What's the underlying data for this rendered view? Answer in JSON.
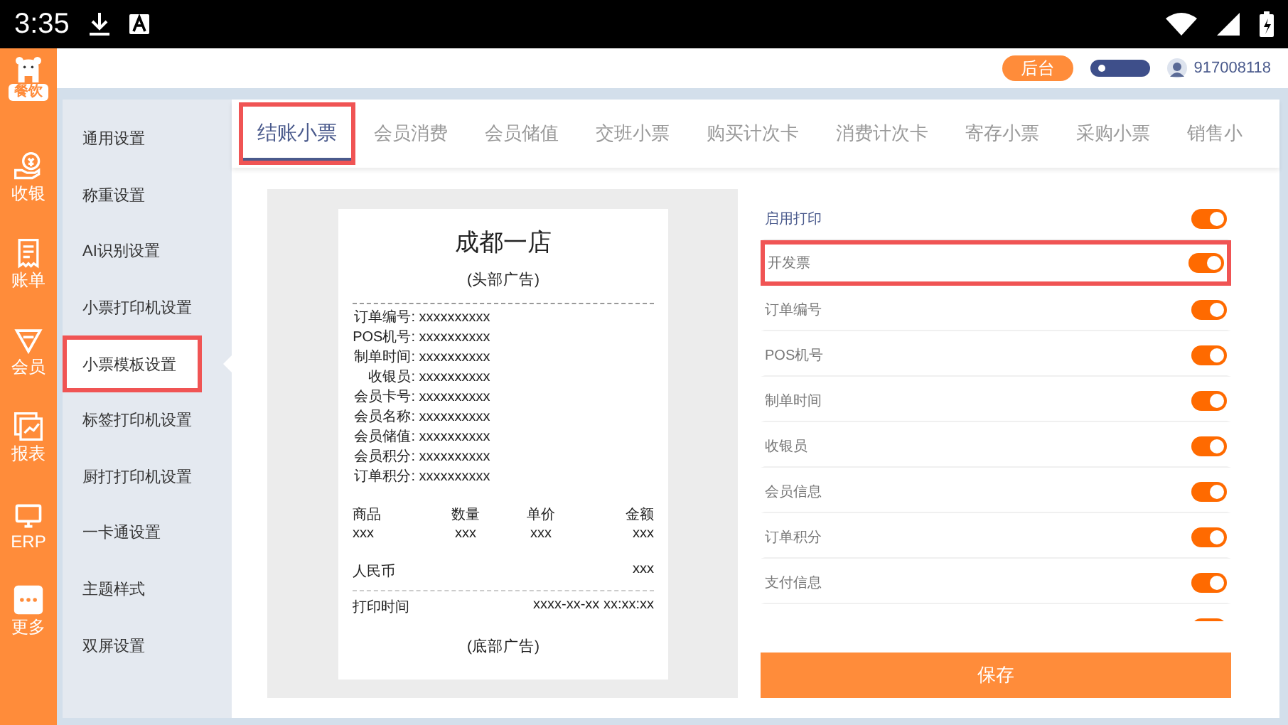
{
  "status_bar": {
    "time": "3:35"
  },
  "rail": {
    "logo_tag": "餐饮",
    "items": [
      {
        "label": "收银",
        "kind": "cash"
      },
      {
        "label": "账单",
        "kind": "bill"
      },
      {
        "label": "会员",
        "kind": "member"
      },
      {
        "label": "报表",
        "kind": "report"
      },
      {
        "label": "ERP",
        "kind": "erp"
      },
      {
        "label": "更多",
        "kind": "more"
      }
    ]
  },
  "header": {
    "backend_button": "后台",
    "account": "917008118"
  },
  "sidebar": {
    "items": [
      {
        "label": "通用设置",
        "selected": false,
        "highlighted": false
      },
      {
        "label": "称重设置",
        "selected": false,
        "highlighted": false
      },
      {
        "label": "AI识别设置",
        "selected": false,
        "highlighted": false
      },
      {
        "label": "小票打印机设置",
        "selected": false,
        "highlighted": false
      },
      {
        "label": "小票模板设置",
        "selected": true,
        "highlighted": true
      },
      {
        "label": "标签打印机设置",
        "selected": false,
        "highlighted": false
      },
      {
        "label": "厨打打印机设置",
        "selected": false,
        "highlighted": false
      },
      {
        "label": "一卡通设置",
        "selected": false,
        "highlighted": false
      },
      {
        "label": "主题样式",
        "selected": false,
        "highlighted": false
      },
      {
        "label": "双屏设置",
        "selected": false,
        "highlighted": false
      }
    ]
  },
  "tabs": [
    {
      "label": "结账小票",
      "selected": true,
      "highlighted": true
    },
    {
      "label": "会员消费",
      "selected": false,
      "highlighted": false
    },
    {
      "label": "会员储值",
      "selected": false,
      "highlighted": false
    },
    {
      "label": "交班小票",
      "selected": false,
      "highlighted": false
    },
    {
      "label": "购买计次卡",
      "selected": false,
      "highlighted": false
    },
    {
      "label": "消费计次卡",
      "selected": false,
      "highlighted": false
    },
    {
      "label": "寄存小票",
      "selected": false,
      "highlighted": false
    },
    {
      "label": "采购小票",
      "selected": false,
      "highlighted": false
    },
    {
      "label": "销售小",
      "selected": false,
      "highlighted": false
    }
  ],
  "receipt": {
    "title": "成都一店",
    "header_ad": "(头部广告)",
    "fields": [
      {
        "label": "订单编号:",
        "value": "xxxxxxxxxx"
      },
      {
        "label": "POS机号:",
        "value": "xxxxxxxxxx"
      },
      {
        "label": "制单时间:",
        "value": "xxxxxxxxxx"
      },
      {
        "label": "收银员:",
        "value": "xxxxxxxxxx"
      },
      {
        "label": "会员卡号:",
        "value": "xxxxxxxxxx"
      },
      {
        "label": "会员名称:",
        "value": "xxxxxxxxxx"
      },
      {
        "label": "会员储值:",
        "value": "xxxxxxxxxx"
      },
      {
        "label": "会员积分:",
        "value": "xxxxxxxxxx"
      },
      {
        "label": "订单积分:",
        "value": "xxxxxxxxxx"
      }
    ],
    "columns": [
      "商品",
      "数量",
      "单价",
      "金额"
    ],
    "rows": [
      [
        "xxx",
        "xxx",
        "xxx",
        "xxx"
      ]
    ],
    "total": {
      "label": "人民币",
      "value": "xxx"
    },
    "print_time": {
      "label": "打印时间",
      "value": "xxxx-xx-xx xx:xx:xx"
    },
    "footer_ad": "(底部广告)"
  },
  "settings": {
    "toggles": [
      {
        "label": "启用打印",
        "kind": "master",
        "on": true,
        "highlighted": false
      },
      {
        "label": "开发票",
        "kind": "field",
        "on": true,
        "highlighted": true
      },
      {
        "label": "订单编号",
        "kind": "field",
        "on": true,
        "highlighted": false
      },
      {
        "label": "POS机号",
        "kind": "field",
        "on": true,
        "highlighted": false
      },
      {
        "label": "制单时间",
        "kind": "field",
        "on": true,
        "highlighted": false
      },
      {
        "label": "收银员",
        "kind": "field",
        "on": true,
        "highlighted": false
      },
      {
        "label": "会员信息",
        "kind": "field",
        "on": true,
        "highlighted": false
      },
      {
        "label": "订单积分",
        "kind": "field",
        "on": true,
        "highlighted": false
      },
      {
        "label": "支付信息",
        "kind": "field",
        "on": true,
        "highlighted": false
      },
      {
        "kind": "field",
        "on": true,
        "highlighted": false
      }
    ],
    "save_button": "保存"
  }
}
